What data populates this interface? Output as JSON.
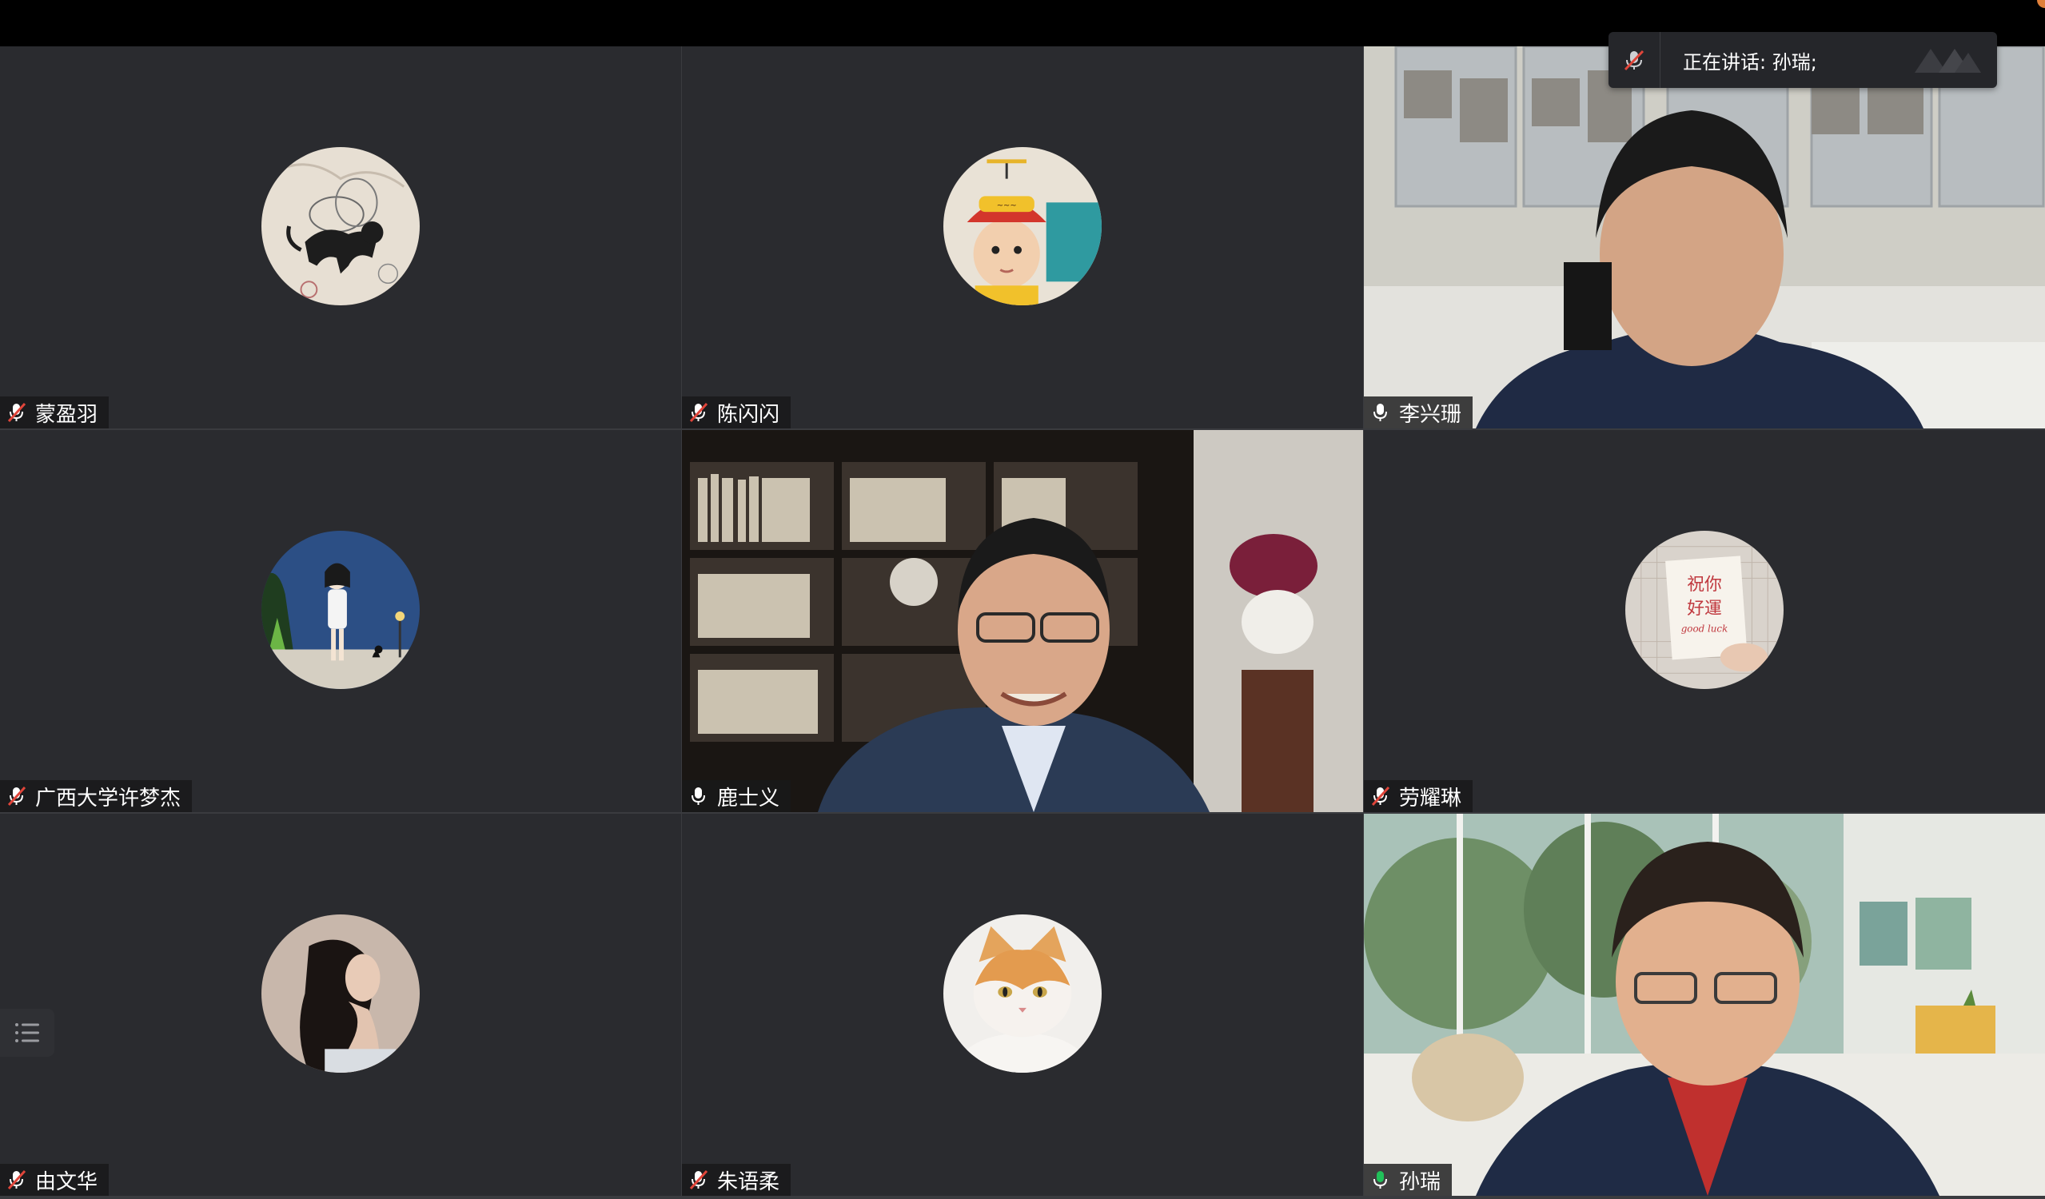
{
  "window": {
    "accent_active": "#21c15a",
    "mic_muted_color": "#e0453a"
  },
  "speaking_banner": {
    "label": "正在讲话: 孙瑞;",
    "icon": "mic-muted-icon"
  },
  "participants": [
    {
      "name": "蒙盈羽",
      "mic": "muted",
      "view": "avatar",
      "avatar_desc": "cat-sketch-avatar"
    },
    {
      "name": "陈闪闪",
      "mic": "muted",
      "view": "avatar",
      "avatar_desc": "child-hat-avatar"
    },
    {
      "name": "李兴珊",
      "mic": "on",
      "view": "video"
    },
    {
      "name": "广西大学许梦杰",
      "mic": "muted",
      "view": "avatar",
      "avatar_desc": "illustration-girl-avatar"
    },
    {
      "name": "鹿士义",
      "mic": "on",
      "view": "video"
    },
    {
      "name": "劳耀琳",
      "mic": "muted",
      "view": "avatar",
      "avatar_desc": "good-luck-card-avatar"
    },
    {
      "name": "由文华",
      "mic": "muted",
      "view": "avatar",
      "avatar_desc": "woman-profile-avatar"
    },
    {
      "name": "朱语柔",
      "mic": "muted",
      "view": "avatar",
      "avatar_desc": "cat-photo-avatar"
    },
    {
      "name": "孙瑞",
      "mic": "speaking",
      "view": "video",
      "active": true
    }
  ],
  "avatar_card": {
    "line1": "祝你",
    "line2": "好運",
    "line3": "good luck"
  },
  "side_button": {
    "icon": "list-icon"
  }
}
